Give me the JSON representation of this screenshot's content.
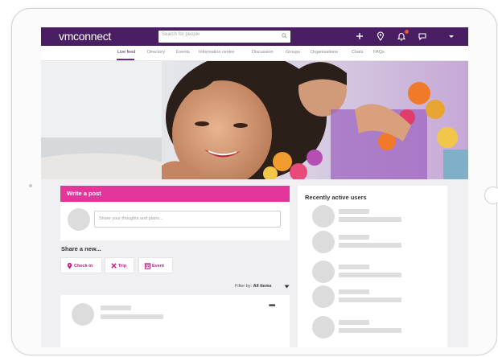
{
  "header": {
    "logo": "vmconnect",
    "search_placeholder": "Search for people"
  },
  "toolbar_icons": [
    "plus-icon",
    "pin-icon",
    "notification-bell-icon",
    "chat-icon",
    "caret-down-icon"
  ],
  "nav": {
    "items": [
      "Live feed",
      "Directory",
      "Events",
      "Information centre",
      "Discussion",
      "Groups",
      "Organisations",
      "Chats",
      "FAQs"
    ],
    "active": "Live feed"
  },
  "composer": {
    "title": "Write a post",
    "placeholder": "Share your thoughts and plans..."
  },
  "share": {
    "title": "Share a new...",
    "buttons": [
      {
        "label": "Check-in",
        "icon": "location-pin-icon"
      },
      {
        "label": "Trip",
        "icon": "plane-icon"
      },
      {
        "label": "Event",
        "icon": "calendar-icon"
      }
    ]
  },
  "filter": {
    "label": "Filter by:",
    "value": "All items"
  },
  "feed": {
    "more": "•••"
  },
  "sidebar": {
    "title": "Recently active users"
  },
  "colors": {
    "brand_purple": "#4a1e63",
    "accent_pink": "#e4359a"
  }
}
